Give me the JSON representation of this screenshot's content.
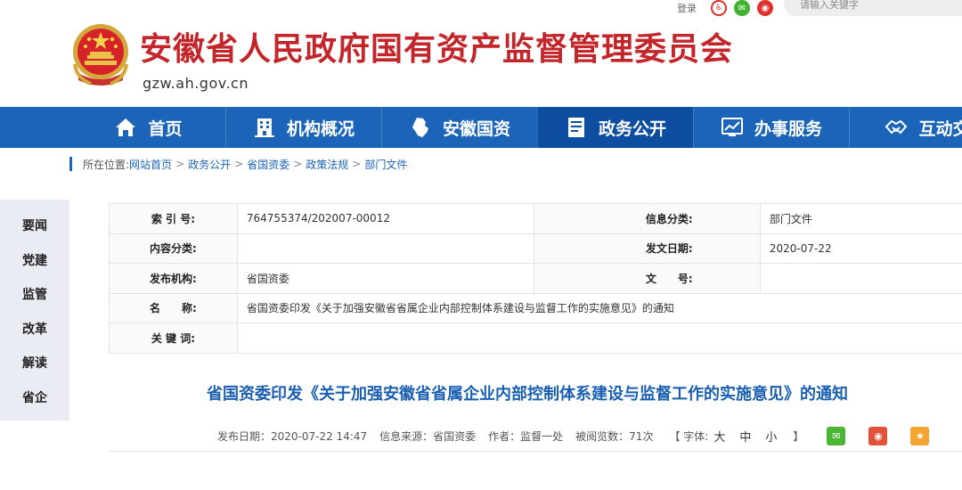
{
  "topbar": {
    "login_label": "登录",
    "search_placeholder": "请输入关键字"
  },
  "site": {
    "title": "安徽省人民政府国有资产监督管理委员会",
    "domain": "gzw.ah.gov.cn"
  },
  "nav": {
    "items": [
      {
        "label": "首页",
        "icon": "home-icon"
      },
      {
        "label": "机构概况",
        "icon": "building-icon"
      },
      {
        "label": "安徽国资",
        "icon": "map-icon"
      },
      {
        "label": "政务公开",
        "icon": "document-icon"
      },
      {
        "label": "办事服务",
        "icon": "chart-icon"
      },
      {
        "label": "互动交",
        "icon": "handshake-icon"
      }
    ]
  },
  "breadcrumb": {
    "prefix": "所在位置:",
    "items": [
      "网站首页",
      "政务公开",
      "省国资委",
      "政策法规",
      "部门文件"
    ],
    "separator": ">"
  },
  "sidebar": {
    "items": [
      "要闻",
      "党建",
      "监管",
      "改革",
      "解读",
      "省企"
    ]
  },
  "info": {
    "index_label": "索 引 号:",
    "index_value": "764755374/202007-00012",
    "category_label": "信息分类:",
    "category_value": "部门文件",
    "content_label": "内容分类:",
    "content_value": "",
    "date_label": "发文日期:",
    "date_value": "2020-07-22",
    "org_label": "发布机构:",
    "org_value": "省国资委",
    "docno_label": "文　　号:",
    "docno_value": "",
    "name_label": "名　　称:",
    "name_value": "省国资委印发《关于加强安徽省省属企业内部控制体系建设与监督工作的实施意见》的通知",
    "keywords_label": "关 键 词:",
    "keywords_value": ""
  },
  "article": {
    "title": "省国资委印发《关于加强安徽省省属企业内部控制体系建设与监督工作的实施意见》的通知",
    "publish_date": "发布日期：2020-07-22 14:47",
    "source": "信息来源：省国资委",
    "author": "作者：监督一处",
    "views": "被阅览数：71次",
    "font_label": "【 字体:",
    "font_large": "大",
    "font_medium": "中",
    "font_small": "小",
    "font_close": "】"
  },
  "colors": {
    "nav_bg": "#1b64b8",
    "nav_active": "#0d4ea1",
    "title_red": "#c3262a",
    "article_blue": "#1b5fb2"
  }
}
